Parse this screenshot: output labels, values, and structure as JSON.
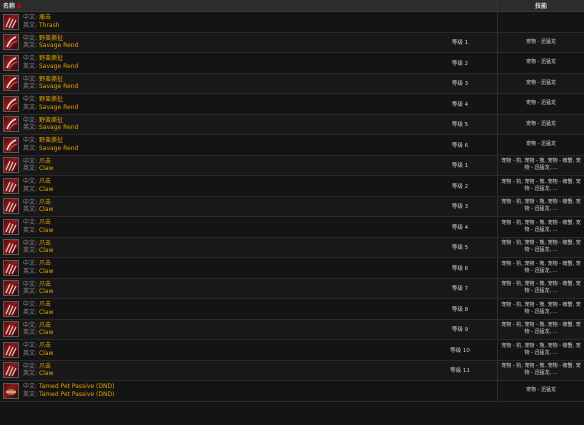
{
  "header": {
    "name_label": "名称",
    "sort_indicator": "▲",
    "skill_label": "技能"
  },
  "labels": {
    "zh": "中文:",
    "en": "英文:"
  },
  "rows": [
    {
      "zh": "痛击",
      "en": "Thrash",
      "rank": "",
      "skill": "",
      "icon": "claw-icon"
    },
    {
      "zh": "野蛮撕扯",
      "en": "Savage Rend",
      "rank": "等级 1",
      "skill": "宠物 - 迅猛龙",
      "icon": "savage-rend-icon"
    },
    {
      "zh": "野蛮撕扯",
      "en": "Savage Rend",
      "rank": "等级 2",
      "skill": "宠物 - 迅猛龙",
      "icon": "savage-rend-icon"
    },
    {
      "zh": "野蛮撕扯",
      "en": "Savage Rend",
      "rank": "等级 3",
      "skill": "宠物 - 迅猛龙",
      "icon": "savage-rend-icon"
    },
    {
      "zh": "野蛮撕扯",
      "en": "Savage Rend",
      "rank": "等级 4",
      "skill": "宠物 - 迅猛龙",
      "icon": "savage-rend-icon"
    },
    {
      "zh": "野蛮撕扯",
      "en": "Savage Rend",
      "rank": "等级 5",
      "skill": "宠物 - 迅猛龙",
      "icon": "savage-rend-icon"
    },
    {
      "zh": "野蛮撕扯",
      "en": "Savage Rend",
      "rank": "等级 6",
      "skill": "宠物 - 迅猛龙",
      "icon": "savage-rend-icon"
    },
    {
      "zh": "爪击",
      "en": "Claw",
      "rank": "等级 1",
      "skill": "宠物 - 豹, 宠物 - 熊, 宠物 - 螃蟹, 宠物 - 迅猛龙, ...",
      "icon": "claw-icon"
    },
    {
      "zh": "爪击",
      "en": "Claw",
      "rank": "等级 2",
      "skill": "宠物 - 豹, 宠物 - 熊, 宠物 - 螃蟹, 宠物 - 迅猛龙, ...",
      "icon": "claw-icon"
    },
    {
      "zh": "爪击",
      "en": "Claw",
      "rank": "等级 3",
      "skill": "宠物 - 豹, 宠物 - 熊, 宠物 - 螃蟹, 宠物 - 迅猛龙, ...",
      "icon": "claw-icon"
    },
    {
      "zh": "爪击",
      "en": "Claw",
      "rank": "等级 4",
      "skill": "宠物 - 豹, 宠物 - 熊, 宠物 - 螃蟹, 宠物 - 迅猛龙, ...",
      "icon": "claw-icon"
    },
    {
      "zh": "爪击",
      "en": "Claw",
      "rank": "等级 5",
      "skill": "宠物 - 豹, 宠物 - 熊, 宠物 - 螃蟹, 宠物 - 迅猛龙, ...",
      "icon": "claw-icon"
    },
    {
      "zh": "爪击",
      "en": "Claw",
      "rank": "等级 6",
      "skill": "宠物 - 豹, 宠物 - 熊, 宠物 - 螃蟹, 宠物 - 迅猛龙, ...",
      "icon": "claw-icon"
    },
    {
      "zh": "爪击",
      "en": "Claw",
      "rank": "等级 7",
      "skill": "宠物 - 豹, 宠物 - 熊, 宠物 - 螃蟹, 宠物 - 迅猛龙, ...",
      "icon": "claw-icon"
    },
    {
      "zh": "爪击",
      "en": "Claw",
      "rank": "等级 8",
      "skill": "宠物 - 豹, 宠物 - 熊, 宠物 - 螃蟹, 宠物 - 迅猛龙, ...",
      "icon": "claw-icon"
    },
    {
      "zh": "爪击",
      "en": "Claw",
      "rank": "等级 9",
      "skill": "宠物 - 豹, 宠物 - 熊, 宠物 - 螃蟹, 宠物 - 迅猛龙, ...",
      "icon": "claw-icon"
    },
    {
      "zh": "爪击",
      "en": "Claw",
      "rank": "等级 10",
      "skill": "宠物 - 豹, 宠物 - 熊, 宠物 - 螃蟹, 宠物 - 迅猛龙, ...",
      "icon": "claw-icon"
    },
    {
      "zh": "爪击",
      "en": "Claw",
      "rank": "等级 11",
      "skill": "宠物 - 豹, 宠物 - 熊, 宠物 - 螃蟹, 宠物 - 迅猛龙, ...",
      "icon": "claw-icon"
    },
    {
      "zh": "Tamed Pet Passive (DND)",
      "en": "Tamed Pet Passive (DND)",
      "rank": "",
      "skill": "宠物 - 迅猛龙",
      "icon": "pet-passive-icon"
    }
  ]
}
